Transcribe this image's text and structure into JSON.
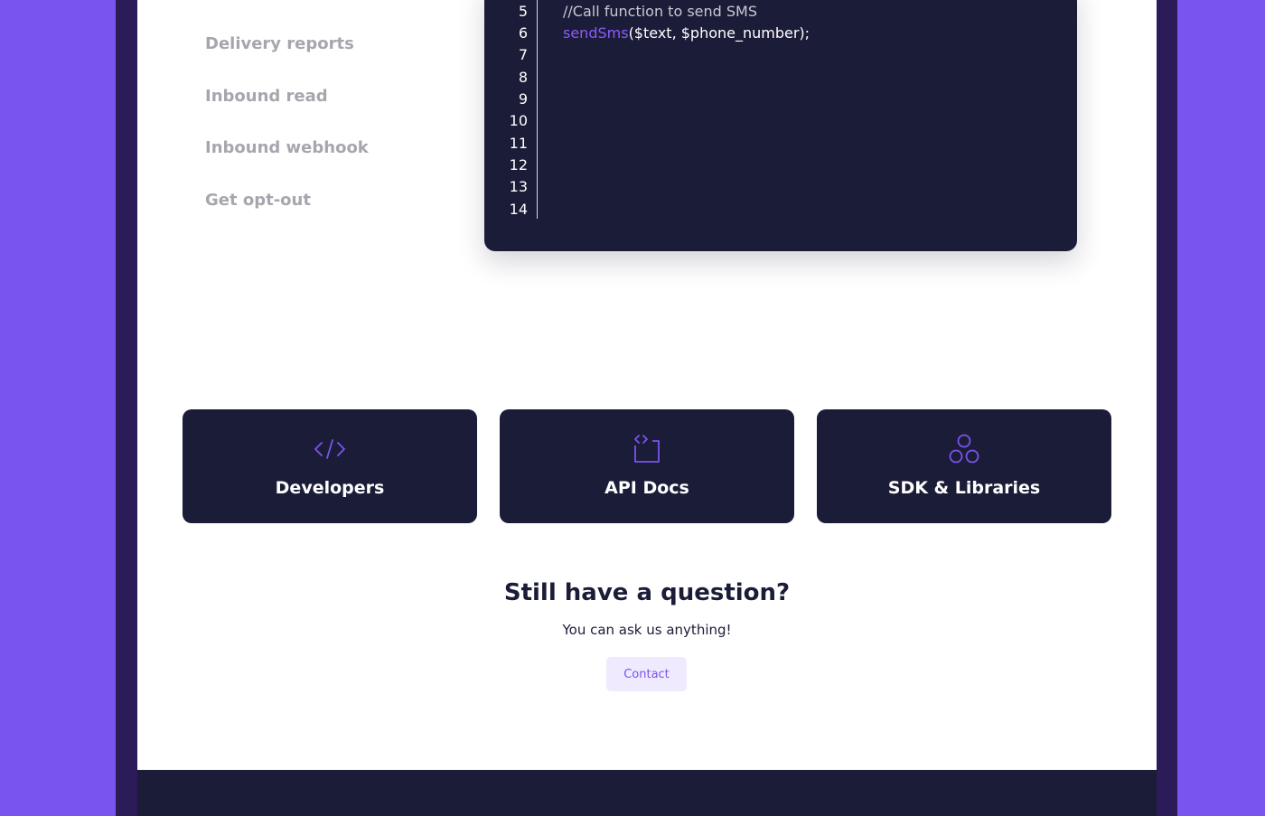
{
  "sidebar": {
    "items": [
      {
        "label": "Delivery reports"
      },
      {
        "label": "Inbound read"
      },
      {
        "label": "Inbound webhook"
      },
      {
        "label": "Get opt-out"
      }
    ]
  },
  "code": {
    "line_numbers": [
      "5",
      "6",
      "7",
      "8",
      "9",
      "10",
      "11",
      "12",
      "13",
      "14"
    ],
    "comment": "//Call function to send SMS",
    "function_name": "sendSms",
    "function_args": "($text, $phone_number);"
  },
  "cards": [
    {
      "label": "Developers",
      "icon": "code-brackets-icon"
    },
    {
      "label": "API Docs",
      "icon": "api-docs-icon"
    },
    {
      "label": "SDK & Libraries",
      "icon": "three-circles-icon"
    }
  ],
  "question": {
    "title": "Still have a question?",
    "subtitle": "You can ask us anything!",
    "button_label": "Contact"
  },
  "colors": {
    "accent": "#7a54ef",
    "dark": "#1b1c38",
    "sidebar_text": "#a6a6ae"
  }
}
